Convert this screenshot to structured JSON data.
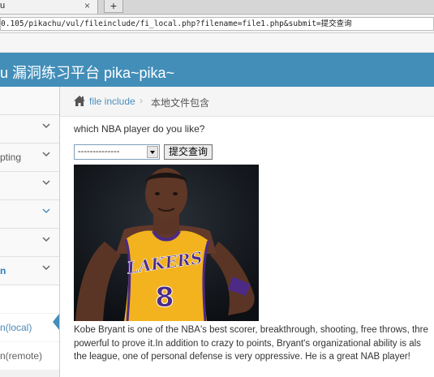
{
  "browser": {
    "tab_title": "u",
    "tab_close": "×",
    "new_tab": "+",
    "url": "0.105/pikachu/vul/fileinclude/fi_local.php?filename=file1.php&submit=提交查询"
  },
  "header": {
    "title": "u 漏洞练习平台 pika~pika~"
  },
  "sidebar": {
    "items": [
      {
        "label": ""
      },
      {
        "label": ""
      },
      {
        "label": "pting"
      },
      {
        "label": ""
      },
      {
        "label": ""
      },
      {
        "label": ""
      },
      {
        "label": "n"
      }
    ],
    "subitems": [
      {
        "label": ""
      },
      {
        "label": "n(local)"
      },
      {
        "label": "n(remote)"
      }
    ]
  },
  "breadcrumb": {
    "link": "file include",
    "separator": "›",
    "current": "本地文件包含"
  },
  "form": {
    "question": "which NBA player do you like?",
    "select_value": "--------------",
    "submit_label": "提交查询"
  },
  "bio": {
    "lines": [
      "Kobe Bryant is one of the NBA's best scorer, breakthrough, shooting, free throws, thre",
      "powerful to prove it.In addition to crazy to points, Bryant's organizational ability is als",
      "the league, one of personal defense is very oppressive. He is a great NAB player!"
    ]
  },
  "colors": {
    "header": "#438eb9",
    "link": "#4c8fbd",
    "jersey": "#f2b31e"
  }
}
